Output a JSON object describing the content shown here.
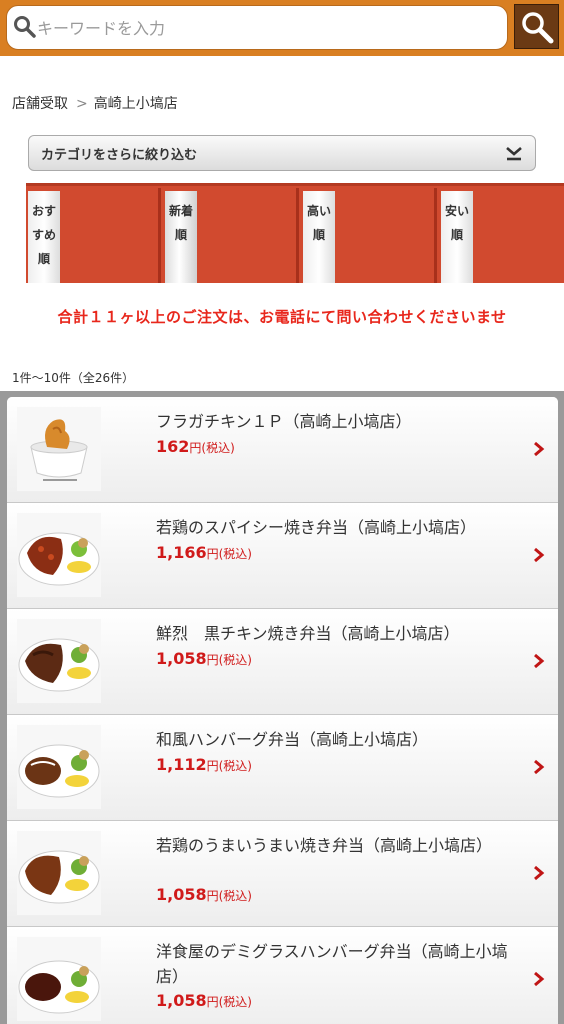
{
  "header": {
    "search_placeholder": "キーワードを入力",
    "colors": {
      "bar": "#d97f22",
      "button": "#6b3a14"
    }
  },
  "breadcrumb": {
    "root": "店舗受取",
    "separator": ">",
    "current": "高崎上小塙店"
  },
  "category": {
    "label": "カテゴリをさらに絞り込む"
  },
  "sort_tabs": [
    {
      "label": "おすすめ順",
      "lines": [
        "おす",
        "すめ",
        "順"
      ],
      "active": false
    },
    {
      "label": "新着順",
      "lines": [
        "新着",
        "順"
      ],
      "active": true
    },
    {
      "label": "高い順",
      "lines": [
        "高い",
        "順"
      ],
      "active": false
    },
    {
      "label": "安い順",
      "lines": [
        "安い",
        "順"
      ],
      "active": false
    }
  ],
  "notice": "合計１１ヶ以上のご注文は、お電話にて問い合わせくださいませ",
  "result_count": "1件～10件（全26件）",
  "price_suffix": {
    "yen": "円",
    "tax": "(税込)"
  },
  "products": [
    {
      "name": "フラガチキン１Ｐ（高崎上小塙店）",
      "price": "162",
      "image": "fried-chicken-cup"
    },
    {
      "name": "若鶏のスパイシー焼き弁当（高崎上小塙店）",
      "price": "1,166",
      "image": "bento-spicy"
    },
    {
      "name": "鮮烈　黒チキン焼き弁当（高崎上小塙店）",
      "price": "1,058",
      "image": "bento-black-chicken"
    },
    {
      "name": "和風ハンバーグ弁当（高崎上小塙店）",
      "price": "1,112",
      "image": "bento-hamburg"
    },
    {
      "name": "若鶏のうまいうまい焼き弁当（高崎上小塙店）",
      "price": "1,058",
      "image": "bento-umai"
    },
    {
      "name": "洋食屋のデミグラスハンバーグ弁当（高崎上小塙店）",
      "price": "1,058",
      "image": "bento-demiglace"
    }
  ]
}
